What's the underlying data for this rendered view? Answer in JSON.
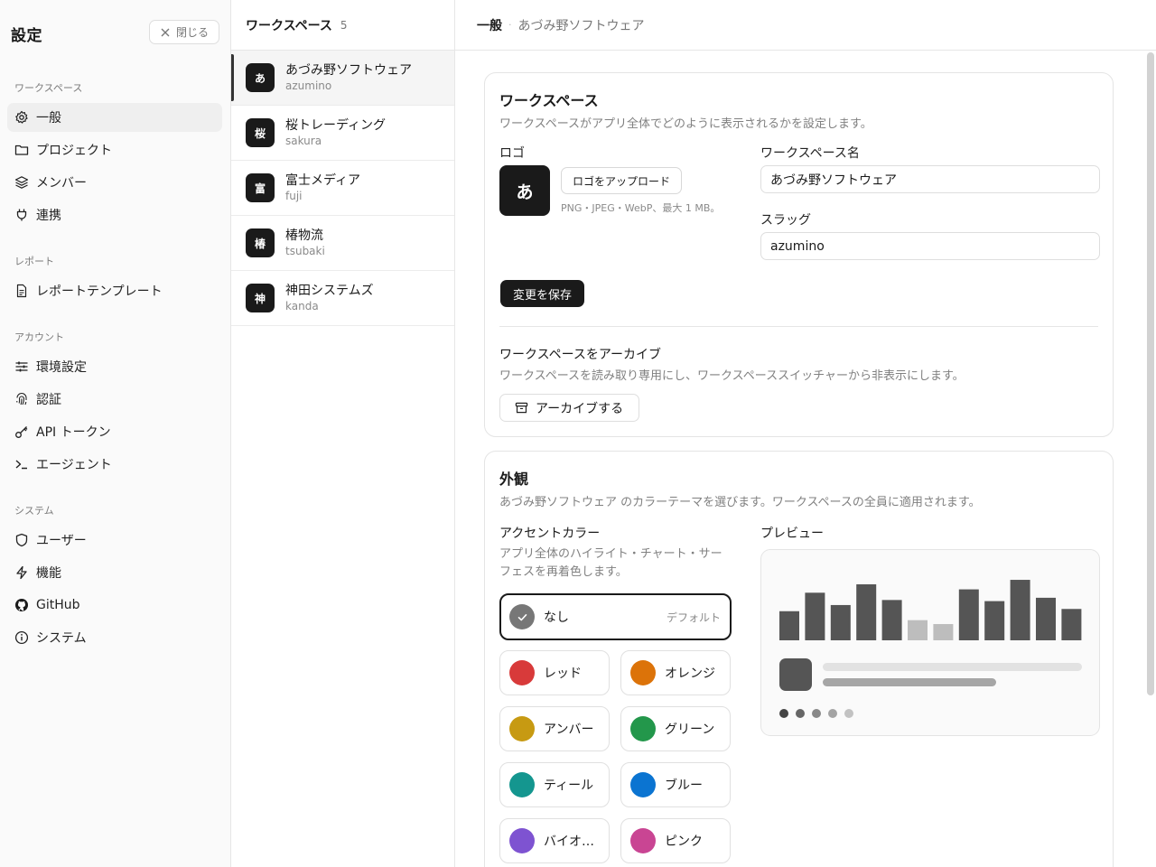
{
  "sidebar": {
    "title": "設定",
    "close_label": "閉じる",
    "sections": [
      {
        "label": "ワークスペース"
      },
      {
        "label": "レポート"
      },
      {
        "label": "アカウント"
      },
      {
        "label": "システム"
      }
    ],
    "items": [
      {
        "label": "一般",
        "icon": "gear-icon",
        "active": true
      },
      {
        "label": "プロジェクト",
        "icon": "folder-icon"
      },
      {
        "label": "メンバー",
        "icon": "layers-icon"
      },
      {
        "label": "連携",
        "icon": "plug-icon"
      },
      {
        "label": "レポートテンプレート",
        "icon": "file-text-icon"
      },
      {
        "label": "環境設定",
        "icon": "sliders-icon"
      },
      {
        "label": "認証",
        "icon": "fingerprint-icon"
      },
      {
        "label": "API トークン",
        "icon": "key-icon"
      },
      {
        "label": "エージェント",
        "icon": "terminal-icon"
      },
      {
        "label": "ユーザー",
        "icon": "shield-icon"
      },
      {
        "label": "機能",
        "icon": "zap-icon"
      },
      {
        "label": "GitHub",
        "icon": "github-icon"
      },
      {
        "label": "システム",
        "icon": "info-icon"
      }
    ]
  },
  "workspaces": {
    "title": "ワークスペース",
    "count": "5",
    "items": [
      {
        "avatar": "あ",
        "name": "あづみ野ソフトウェア",
        "slug": "azumino",
        "active": true
      },
      {
        "avatar": "桜",
        "name": "桜トレーディング",
        "slug": "sakura"
      },
      {
        "avatar": "富",
        "name": "富士メディア",
        "slug": "fuji"
      },
      {
        "avatar": "椿",
        "name": "椿物流",
        "slug": "tsubaki"
      },
      {
        "avatar": "神",
        "name": "神田システムズ",
        "slug": "kanda"
      }
    ]
  },
  "breadcrumb": {
    "current": "一般",
    "separator": "·",
    "parent": "あづみ野ソフトウェア"
  },
  "workspace_card": {
    "title": "ワークスペース",
    "description": "ワークスペースがアプリ全体でどのように表示されるかを設定します。",
    "logo_label": "ロゴ",
    "logo_char": "あ",
    "upload_label": "ロゴをアップロード",
    "upload_hint": "PNG・JPEG・WebP、最大 1 MB。",
    "name_label": "ワークスペース名",
    "name_value": "あづみ野ソフトウェア",
    "slug_label": "スラッグ",
    "slug_value": "azumino",
    "save_label": "変更を保存",
    "archive_title": "ワークスペースをアーカイブ",
    "archive_description": "ワークスペースを読み取り専用にし、ワークスペーススイッチャーから非表示にします。",
    "archive_button": "アーカイブする"
  },
  "appearance_card": {
    "title": "外観",
    "description": "あづみ野ソフトウェア のカラーテーマを選びます。ワークスペースの全員に適用されます。",
    "accent_label": "アクセントカラー",
    "accent_description": "アプリ全体のハイライト・チャート・サーフェスを再着色します。",
    "preview_label": "プレビュー",
    "none_option": {
      "label": "なし",
      "tag": "デフォルト",
      "selected": true
    },
    "colors": [
      {
        "label": "レッド",
        "color": "#d83a3a"
      },
      {
        "label": "オレンジ",
        "color": "#dc7309"
      },
      {
        "label": "アンバー",
        "color": "#c79a12"
      },
      {
        "label": "グリーン",
        "color": "#23974b"
      },
      {
        "label": "ティール",
        "color": "#14968f"
      },
      {
        "label": "ブルー",
        "color": "#0b74d1"
      },
      {
        "label": "バイオ…",
        "color": "#7e53d1"
      },
      {
        "label": "ピンク",
        "color": "#c94593"
      }
    ],
    "preview": {
      "bar_levels": [
        0.52,
        0.85,
        0.63,
        1.0,
        0.72,
        0.36,
        0.29,
        0.91,
        0.7,
        1.08,
        0.76,
        0.56
      ],
      "bar_shades": [
        "#555555",
        "#555555",
        "#555555",
        "#555555",
        "#555555",
        "#bdbdbd",
        "#bdbdbd",
        "#555555",
        "#555555",
        "#555555",
        "#555555",
        "#555555"
      ],
      "dot_colors": [
        "#444444",
        "#666666",
        "#888888",
        "#a3a3a3",
        "#c2c2c2"
      ]
    }
  }
}
